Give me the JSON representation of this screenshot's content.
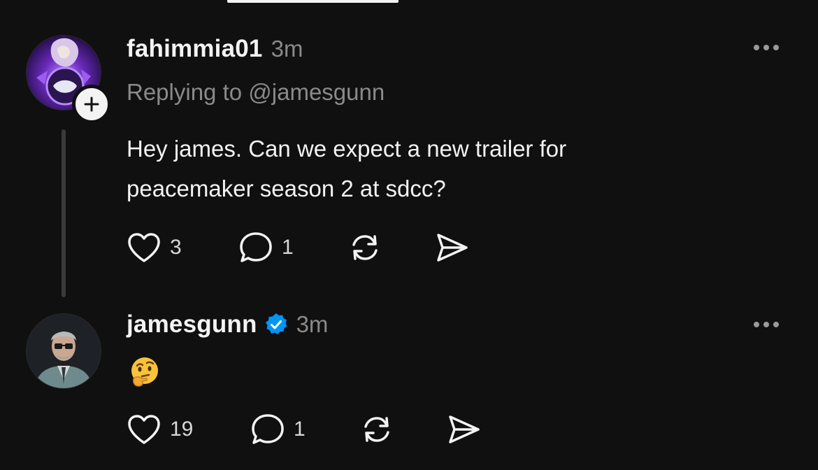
{
  "thread": {
    "reply": {
      "username": "fahimmia01",
      "timestamp": "3m",
      "replying_to": "Replying to @jamesgunn",
      "text_line1": "Hey james. Can we expect a new trailer for",
      "text_line2": "peacemaker season 2 at sdcc?",
      "likes": "3",
      "comments": "1",
      "avatar_icon": "purple-character-avatar",
      "follow_icon": "plus-icon"
    },
    "response": {
      "username": "jamesgunn",
      "timestamp": "3m",
      "verified": true,
      "emoji": "thinking-face",
      "likes": "19",
      "comments": "1",
      "avatar_icon": "man-in-suit-avatar"
    }
  },
  "icons": {
    "like": "heart-icon",
    "comment": "comment-bubble-icon",
    "repost": "repost-icon",
    "share": "send-icon",
    "more": "more-dots-icon",
    "verified": "verified-badge-icon"
  },
  "colors": {
    "background": "#101010",
    "text": "#f3f3f3",
    "muted": "#8a8a8a",
    "verified_blue": "#0095f6"
  }
}
